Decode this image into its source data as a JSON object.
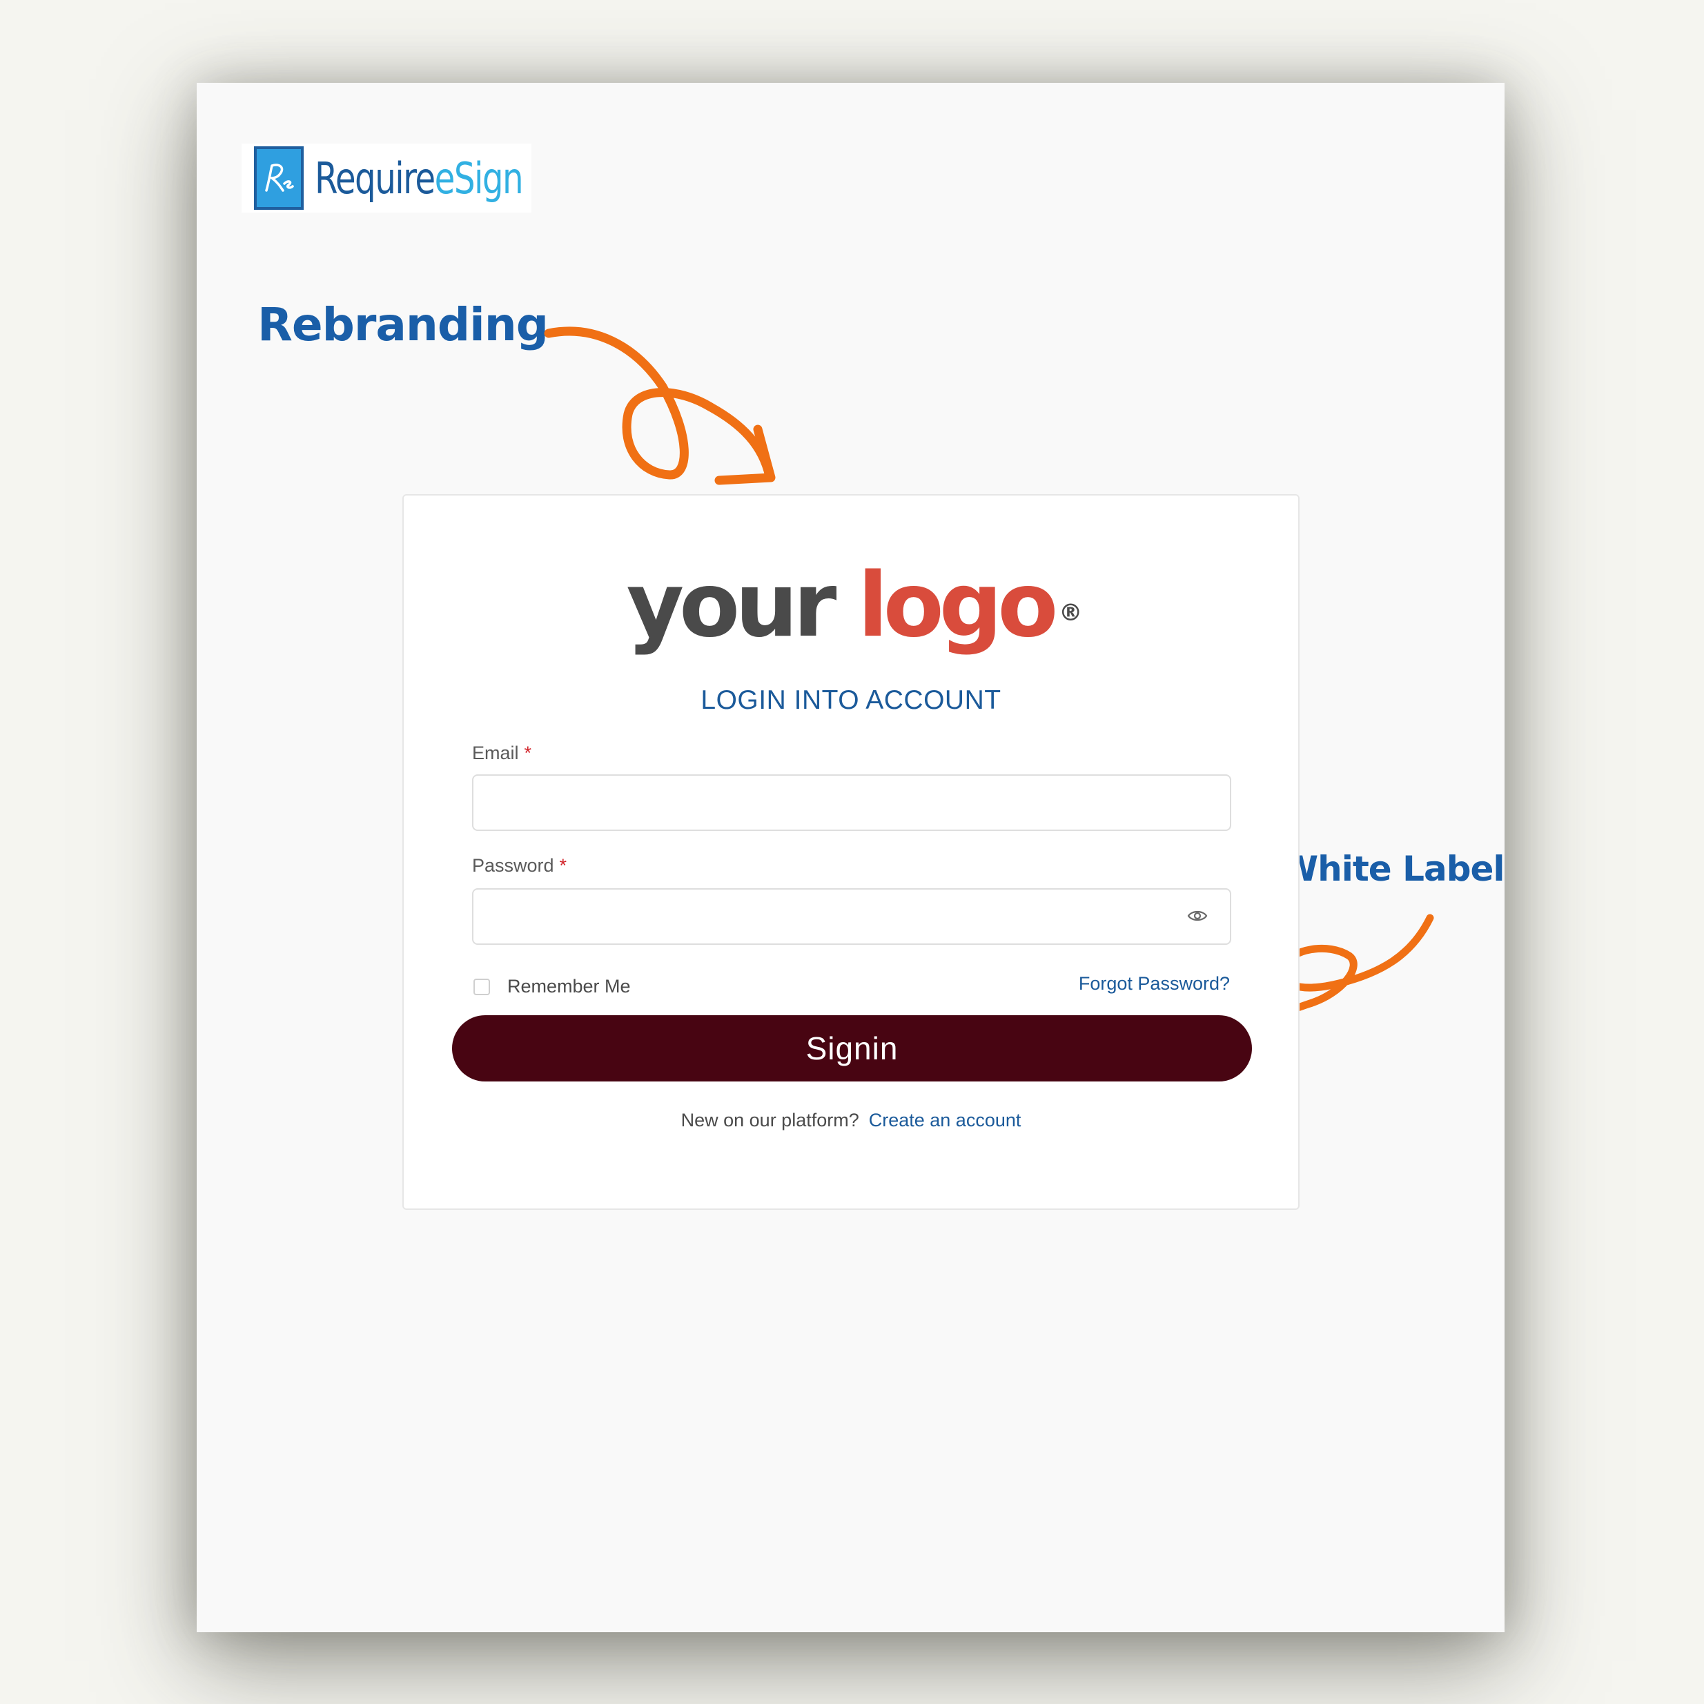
{
  "brand": {
    "name_prefix": "Require",
    "name_suffix": "eSign",
    "badge_icon": "rs-monogram-icon",
    "colors": {
      "badge": "#2f9fe0",
      "prefix": "#1b5a9a",
      "suffix": "#31b0e2"
    }
  },
  "annotations": {
    "rebranding": "Rebranding",
    "white_label": "White Label",
    "arrow_color": "#f07014",
    "text_color": "#1a5ea8"
  },
  "card": {
    "logo": {
      "word1": "your",
      "word2": "logo",
      "mark": "®",
      "colors": {
        "word1": "#4a4a4a",
        "word2": "#d94c3c"
      }
    },
    "title": "LOGIN INTO ACCOUNT",
    "email": {
      "label": "Email",
      "required_mark": "*",
      "value": "",
      "placeholder": ""
    },
    "password": {
      "label": "Password",
      "required_mark": "*",
      "value": "",
      "placeholder": "",
      "toggle_icon": "eye-icon"
    },
    "remember": {
      "label": "Remember Me",
      "checked": false
    },
    "forgot_label": "Forgot Password?",
    "signin_label": "Signin",
    "signin_color": "#480512",
    "signup_prompt": "New on our platform?",
    "signup_link": "Create an account"
  }
}
